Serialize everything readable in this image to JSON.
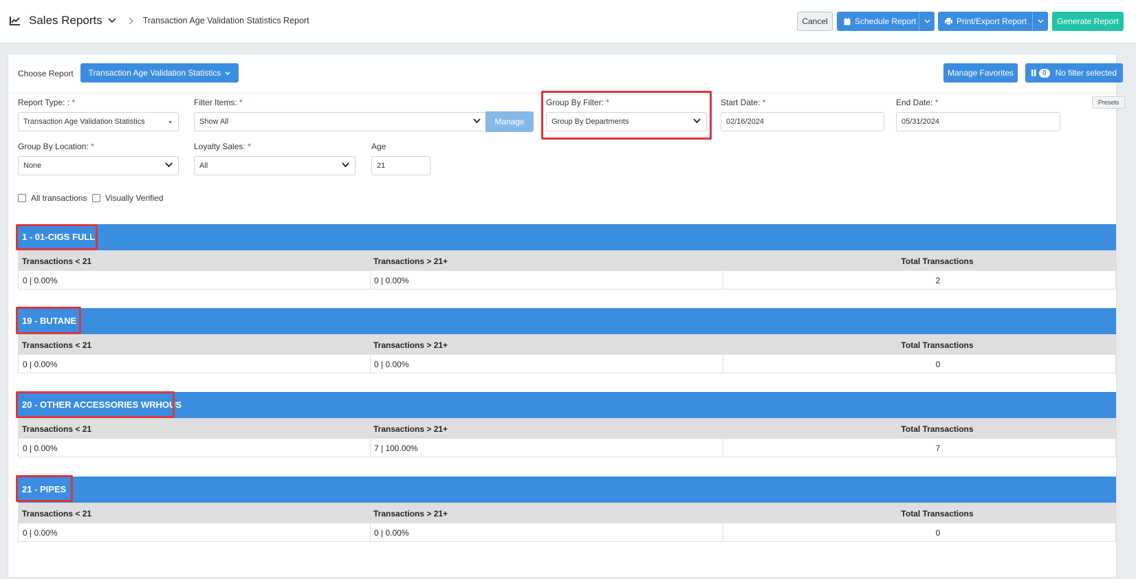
{
  "header": {
    "title": "Sales Reports",
    "breadcrumb": "Transaction Age Validation Statistics Report",
    "cancel": "Cancel",
    "schedule": "Schedule Report",
    "print": "Print/Export Report",
    "generate": "Generate Report"
  },
  "report_bar": {
    "choose_label": "Choose Report",
    "choose_value": "Transaction Age Validation Statistics",
    "manage_favorites": "Manage Favorites",
    "filter_count": "0",
    "filter_text": "No filter selected"
  },
  "filters": {
    "report_type": {
      "label": "Report Type: :",
      "value": "Transaction Age Validation Statistics"
    },
    "filter_items": {
      "label": "Filter Items:",
      "value": "Show All",
      "manage": "Manage"
    },
    "group_by_filter": {
      "label": "Group By Filter:",
      "value": "Group By Departments"
    },
    "start_date": {
      "label": "Start Date:",
      "value": "02/16/2024"
    },
    "end_date": {
      "label": "End Date:",
      "value": "05/31/2024",
      "presets": "Presets"
    },
    "group_by_location": {
      "label": "Group By Location:",
      "value": "None"
    },
    "loyalty_sales": {
      "label": "Loyalty Sales:",
      "value": "All"
    },
    "age": {
      "label": "Age",
      "value": "21"
    },
    "required_mark": "*",
    "checkbox_all": "All transactions",
    "checkbox_verified": "Visually Verified"
  },
  "columns": {
    "under": "Transactions < 21",
    "over": "Transactions > 21+",
    "total": "Total Transactions"
  },
  "groups": [
    {
      "title": "1 - 01-CIGS FULL",
      "under": "0 | 0.00%",
      "over": "0 | 0.00%",
      "total": "2"
    },
    {
      "title": "19 - BUTANE",
      "under": "0 | 0.00%",
      "over": "0 | 0.00%",
      "total": "0"
    },
    {
      "title": "20 - OTHER ACCESSORIES WRHOUS",
      "under": "0 | 0.00%",
      "over": "7 | 100.00%",
      "total": "7"
    },
    {
      "title": "21 - PIPES",
      "under": "0 | 0.00%",
      "over": "0 | 0.00%",
      "total": "0"
    }
  ],
  "colors": {
    "primary": "#3b8de0",
    "success": "#22c3a6",
    "highlight": "#d9363e"
  }
}
